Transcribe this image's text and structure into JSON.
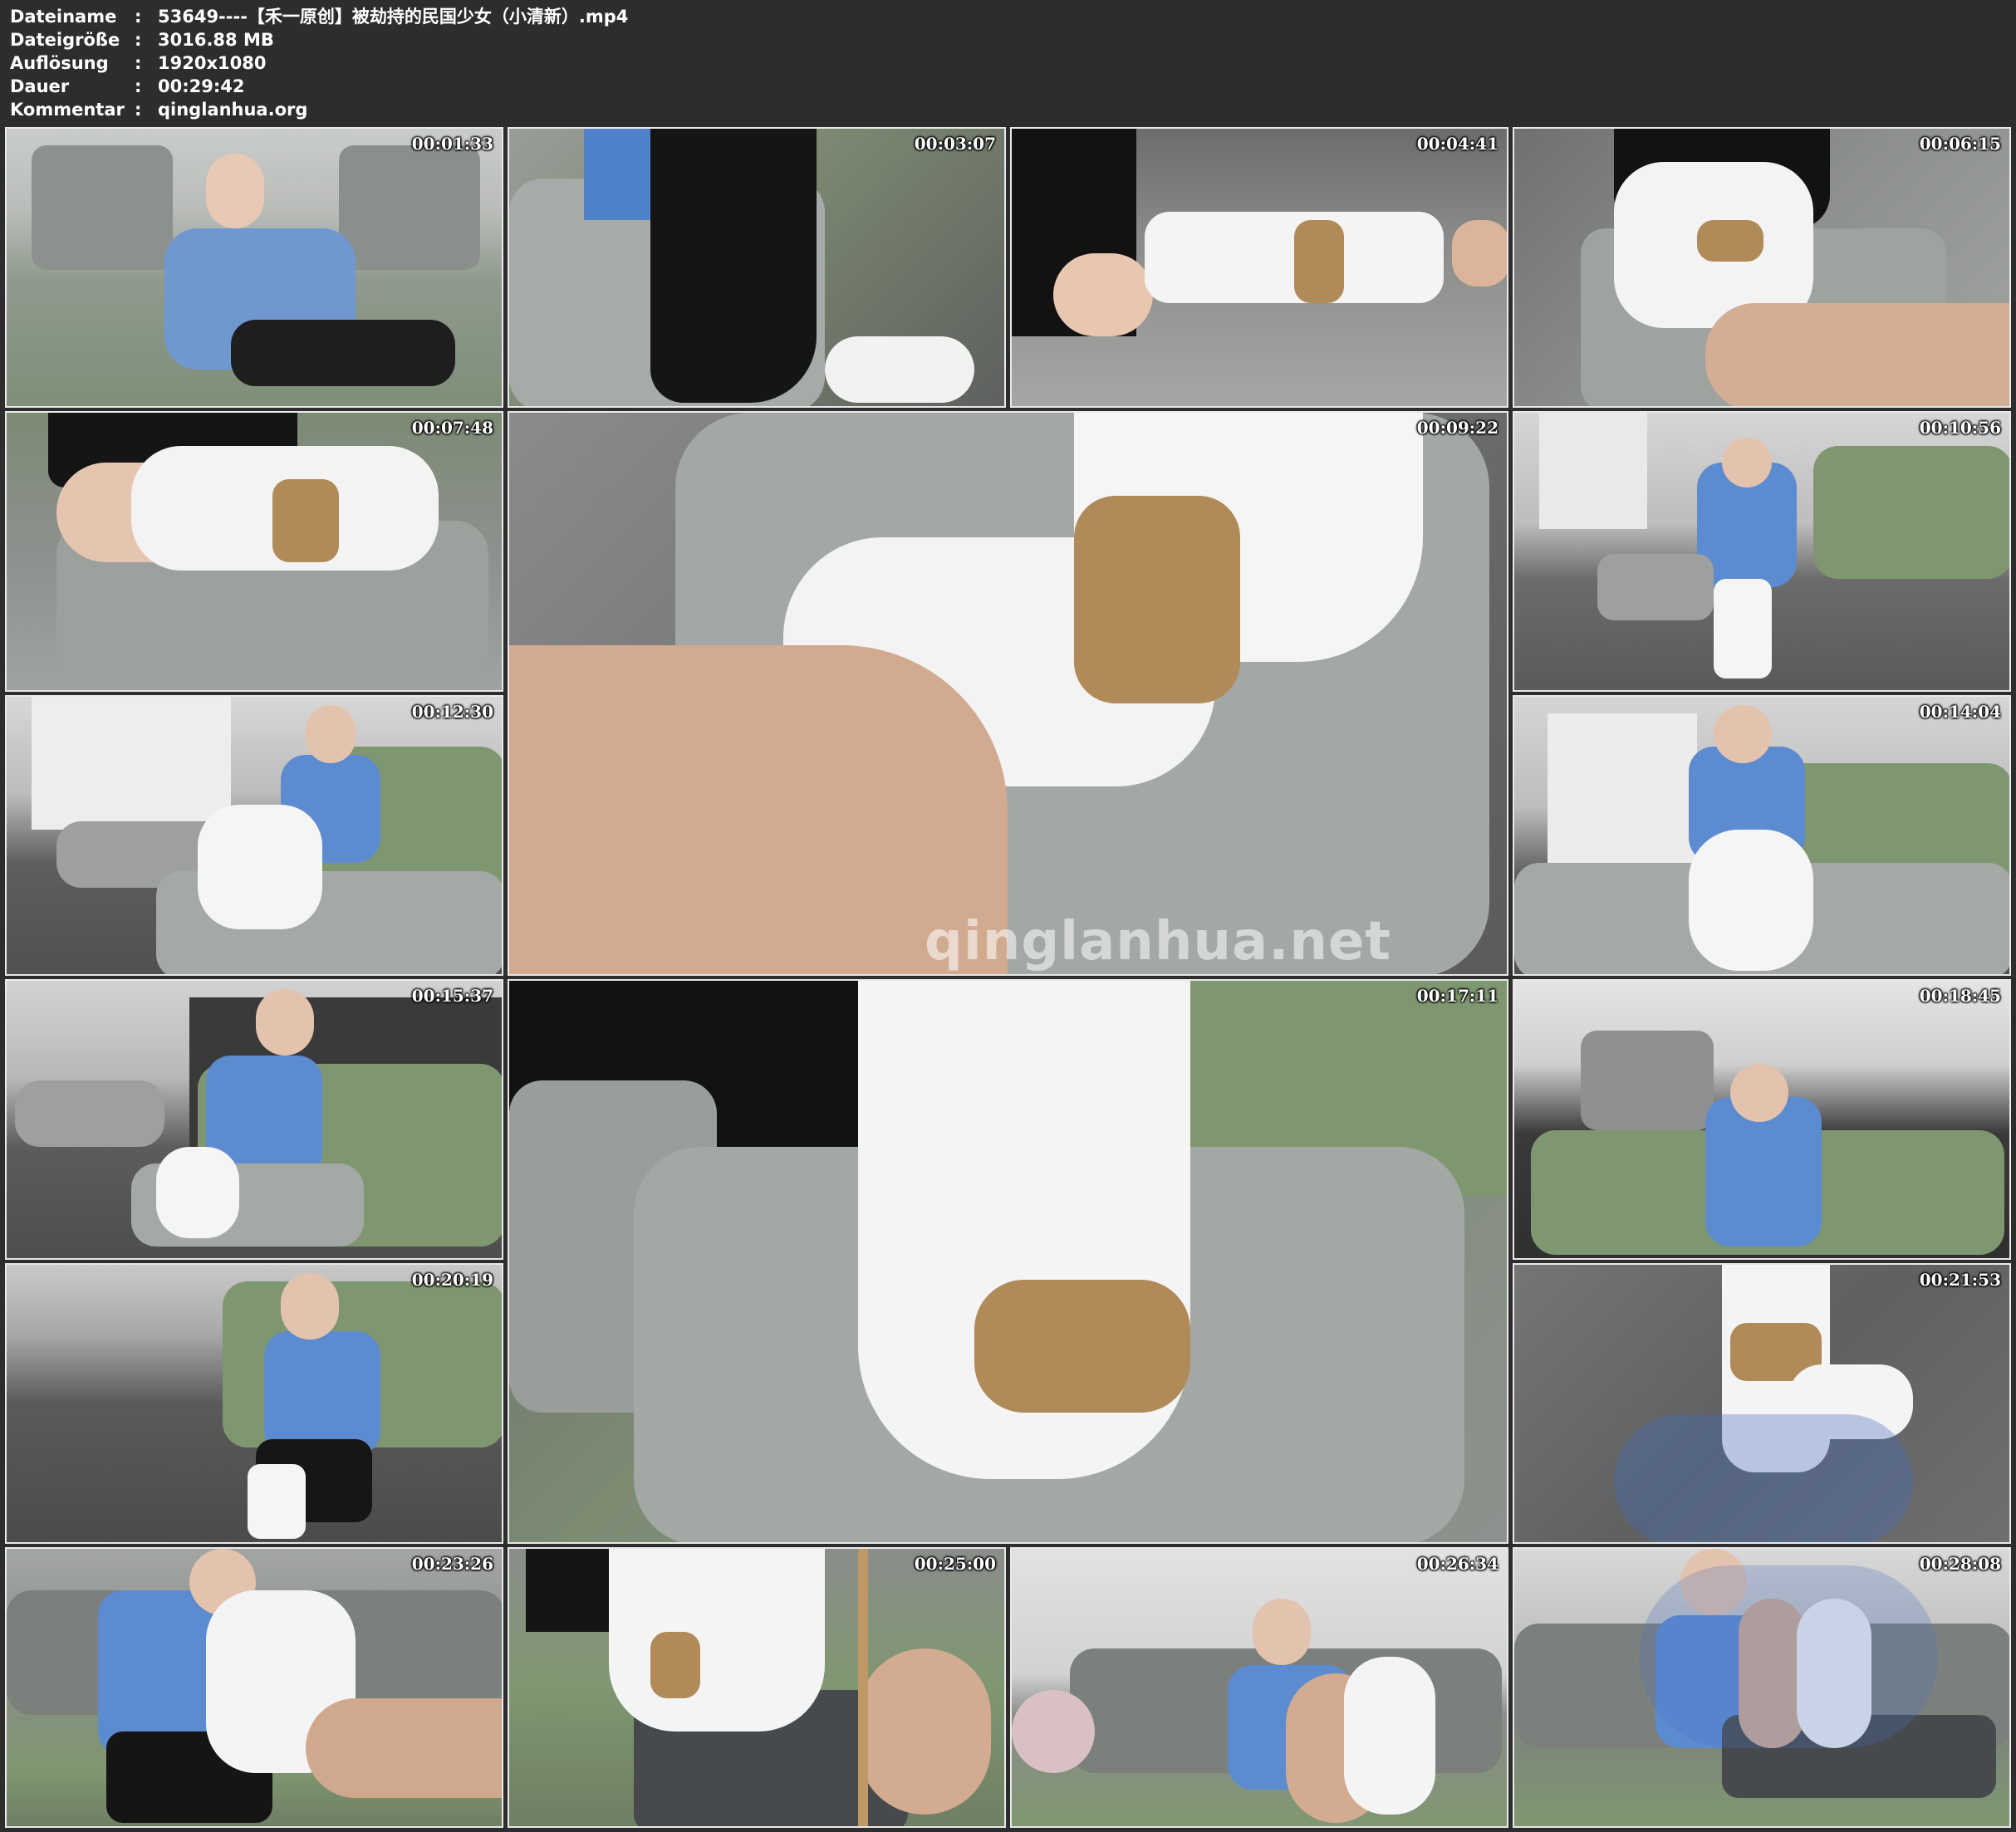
{
  "header": {
    "filename_label": "Dateiname",
    "filename_value": "53649----【禾一原创】被劫持的民国少女（小清新）.mp4",
    "size_label": "Dateigröße",
    "size_value": "3016.88 MB",
    "resolution_label": "Auflösung",
    "resolution_value": "1920x1080",
    "duration_label": "Dauer",
    "duration_value": "00:29:42",
    "comment_label": "Kommentar",
    "comment_value": "qinglanhua.org",
    "separator": ":"
  },
  "thumbnails": [
    {
      "time": "00:01:33"
    },
    {
      "time": "00:03:07"
    },
    {
      "time": "00:04:41"
    },
    {
      "time": "00:06:15"
    },
    {
      "time": "00:07:48"
    },
    {
      "time": "00:09:22"
    },
    {
      "time": "00:10:56"
    },
    {
      "time": "00:12:30"
    },
    {
      "time": "00:14:04"
    },
    {
      "time": "00:15:37"
    },
    {
      "time": "00:17:11"
    },
    {
      "time": "00:18:45"
    },
    {
      "time": "00:20:19"
    },
    {
      "time": "00:21:53"
    },
    {
      "time": "00:23:26"
    },
    {
      "time": "00:25:00"
    },
    {
      "time": "00:26:34"
    },
    {
      "time": "00:28:08"
    }
  ],
  "watermark": "qinglanhua.net"
}
